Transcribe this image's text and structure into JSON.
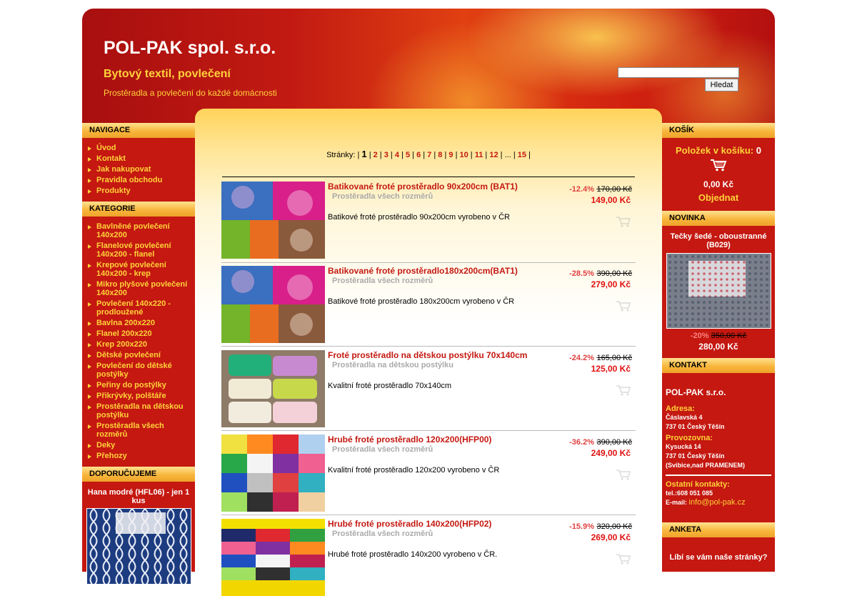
{
  "header": {
    "title": "POL-PAK spol. s.r.o.",
    "subtitle": "Bytový textil, povlečení",
    "tagline": "Prostěradla a povlečení do každé domácnosti",
    "search_placeholder": "",
    "search_button": "Hledat"
  },
  "left": {
    "nav_title": "NAVIGACE",
    "nav_items": [
      "Úvod",
      "Kontakt",
      "Jak nakupovat",
      "Pravidla obchodu",
      "Produkty"
    ],
    "cat_title": "KATEGORIE",
    "cat_items": [
      "Bavlněné povlečení 140x200",
      "Flanelové povlečení 140x200 - flanel",
      "Krepové povlečení 140x200 - krep",
      "Mikro plyšové povlečení 140x200",
      "Povlečení 140x220 - prodloužené",
      "Bavlna 200x220",
      "Flanel 200x220",
      "Krep 200x220",
      "Dětské povlečení",
      "Povlečení do dětské postýlky",
      "Peřiny do postýlky",
      "Přikrývky, polštáře",
      "Prostěradla na dětskou postýlku",
      "Prostěradla všech rozměrů",
      "Deky",
      "Přehozy"
    ],
    "rec_title": "DOPORUČUJEME",
    "rec_item": "Hana modré (HFL06) - jen 1 kus"
  },
  "pager": {
    "label": "Stránky:",
    "current": "1",
    "pages": [
      "2",
      "3",
      "4",
      "5",
      "6",
      "7",
      "8",
      "9",
      "10",
      "11",
      "12"
    ],
    "ellipsis": "...",
    "last": "15"
  },
  "products": [
    {
      "name": "Batikované froté prostěradlo 90x200cm (BAT1)",
      "category": "Prostěradla všech rozměrů",
      "description": "Batikové froté prostěradlo 90x200cm vyrobeno v ČR",
      "discount": "-12.4%",
      "old_price": "170,00 Kč",
      "price": "149,00 Kč"
    },
    {
      "name": "Batikované froté prostěradlo180x200cm(BAT1)",
      "category": "Prostěradla všech rozměrů",
      "description": "Batikové froté prostěradlo 180x200cm vyrobeno v ČR",
      "discount": "-28.5%",
      "old_price": "390,00 Kč",
      "price": "279,00 Kč"
    },
    {
      "name": "Froté prostěradlo na dětskou postýlku 70x140cm",
      "category": "Prostěradla na dětskou postýlku",
      "description": "Kvalitní froté prostěradlo 70x140cm",
      "discount": "-24.2%",
      "old_price": "165,00 Kč",
      "price": "125,00 Kč"
    },
    {
      "name": "Hrubé froté prostěradlo 120x200(HFP00)",
      "category": "Prostěradla všech rozměrů",
      "description": "Kvalitní froté prostěradlo 120x200 vyrobeno v ČR",
      "discount": "-36.2%",
      "old_price": "390,00 Kč",
      "price": "249,00 Kč"
    },
    {
      "name": "Hrubé froté prostěradlo 140x200(HFP02)",
      "category": "Prostěradla všech rozměrů",
      "description": "Hrubé froté prostěradlo 140x200 vyrobeno v ČR.",
      "discount": "-15.9%",
      "old_price": "320,00 Kč",
      "price": "269,00 Kč"
    }
  ],
  "right": {
    "cart_title": "KOŠÍK",
    "cart_label": "Položek v košíku:",
    "cart_count": "0",
    "cart_total": "0,00 Kč",
    "cart_order": "Objednat",
    "new_title": "NOVINKA",
    "new_name": "Tečky šedé - oboustranné (B029)",
    "new_discount": "-20%",
    "new_old_price": "350,00 Kč",
    "new_price": "280,00 Kč",
    "contact_title": "KONTAKT",
    "firm": "POL-PAK s.r.o.",
    "address_label": "Adresa:",
    "address_1": "Čáslavská 4",
    "address_2": "737 01 Český Těšín",
    "office_label": "Provozovna:",
    "office_1": "Kysucká 14",
    "office_2": "737 01 Český Těšín",
    "office_3": "(Svibice,nad PRAMENEM)",
    "other_label": "Ostatní kontakty:",
    "phone": "tel.:608 051 085",
    "email_label": "E-mail:",
    "email": "info@pol-pak.cz",
    "poll_title": "ANKETA",
    "poll_question": "Líbí se vám naše stránky?"
  }
}
